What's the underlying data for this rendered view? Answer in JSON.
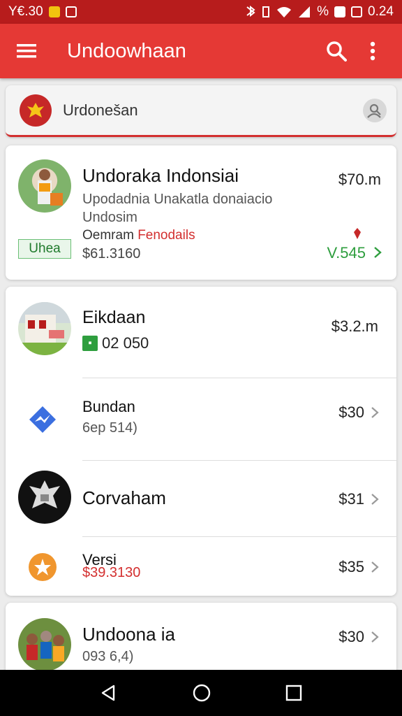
{
  "status_bar": {
    "left_text": "Y€.30",
    "right_text": "0.24",
    "percent_symbol": "%"
  },
  "app_bar": {
    "title": "Undoowhaan"
  },
  "search": {
    "query": "Urdonešan"
  },
  "card1": {
    "title": "Undoraka Indonsiai",
    "line1": "Upodadnia Unakatla donaiacio",
    "line2": "Undosim",
    "label_a": "Oemram",
    "label_b": "Fenodails",
    "badge": "Uhea",
    "amount": "$61.3160",
    "price": "$70.m",
    "value": "V.545"
  },
  "card2": {
    "items": [
      {
        "name": "Eikdaan",
        "code": "02 050",
        "price": "$3.2.m"
      },
      {
        "name": "Bundan",
        "sub": "6ep 514)",
        "price": "$30"
      },
      {
        "name": "Corvaham",
        "price": "$31"
      },
      {
        "name": "Versi",
        "sub": "$39.3130",
        "price": "$35"
      }
    ]
  },
  "card3": {
    "name": "Undoona ia",
    "sub": "093 6,4)",
    "price": "$30"
  },
  "colors": {
    "primary": "#e53935",
    "status": "#b71c1c",
    "green": "#2e9e3e",
    "link_red": "#d32f2f"
  },
  "icons": [
    "menu-icon",
    "search-icon",
    "more-vert-icon",
    "emblem-icon",
    "user-icon",
    "chevron-right-icon",
    "back-icon",
    "home-icon",
    "recents-icon"
  ]
}
